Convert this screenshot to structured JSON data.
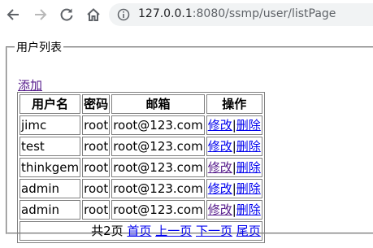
{
  "browser": {
    "url_host": "127.0.0.1",
    "url_rest": ":8080/ssmp/user/listPage"
  },
  "fieldset": {
    "legend": "用户列表"
  },
  "add_link": "添加",
  "table": {
    "headers": [
      "用户名",
      "密码",
      "邮箱",
      "操作"
    ],
    "rows": [
      {
        "username": "jimc",
        "password": "root",
        "email": "root@123.com",
        "edit": "修改",
        "delete": "删除"
      },
      {
        "username": "test",
        "password": "root",
        "email": "root@123.com",
        "edit": "修改",
        "delete": "删除"
      },
      {
        "username": "thinkgem",
        "password": "root",
        "email": "root@123.com",
        "edit": "修改",
        "delete": "删除"
      },
      {
        "username": "admin",
        "password": "root",
        "email": "root@123.com",
        "edit": "修改",
        "delete": "删除"
      },
      {
        "username": "admin",
        "password": "root",
        "email": "root@123.com",
        "edit": "修改",
        "delete": "删除"
      }
    ]
  },
  "pager": {
    "total": "共2页",
    "first": "首页",
    "prev": "上一页",
    "next": "下一页",
    "last": "尾页"
  },
  "colors": {
    "visited_link": "#551a8b",
    "link": "#0000ee",
    "toolbar_icon": "#5f6368"
  }
}
